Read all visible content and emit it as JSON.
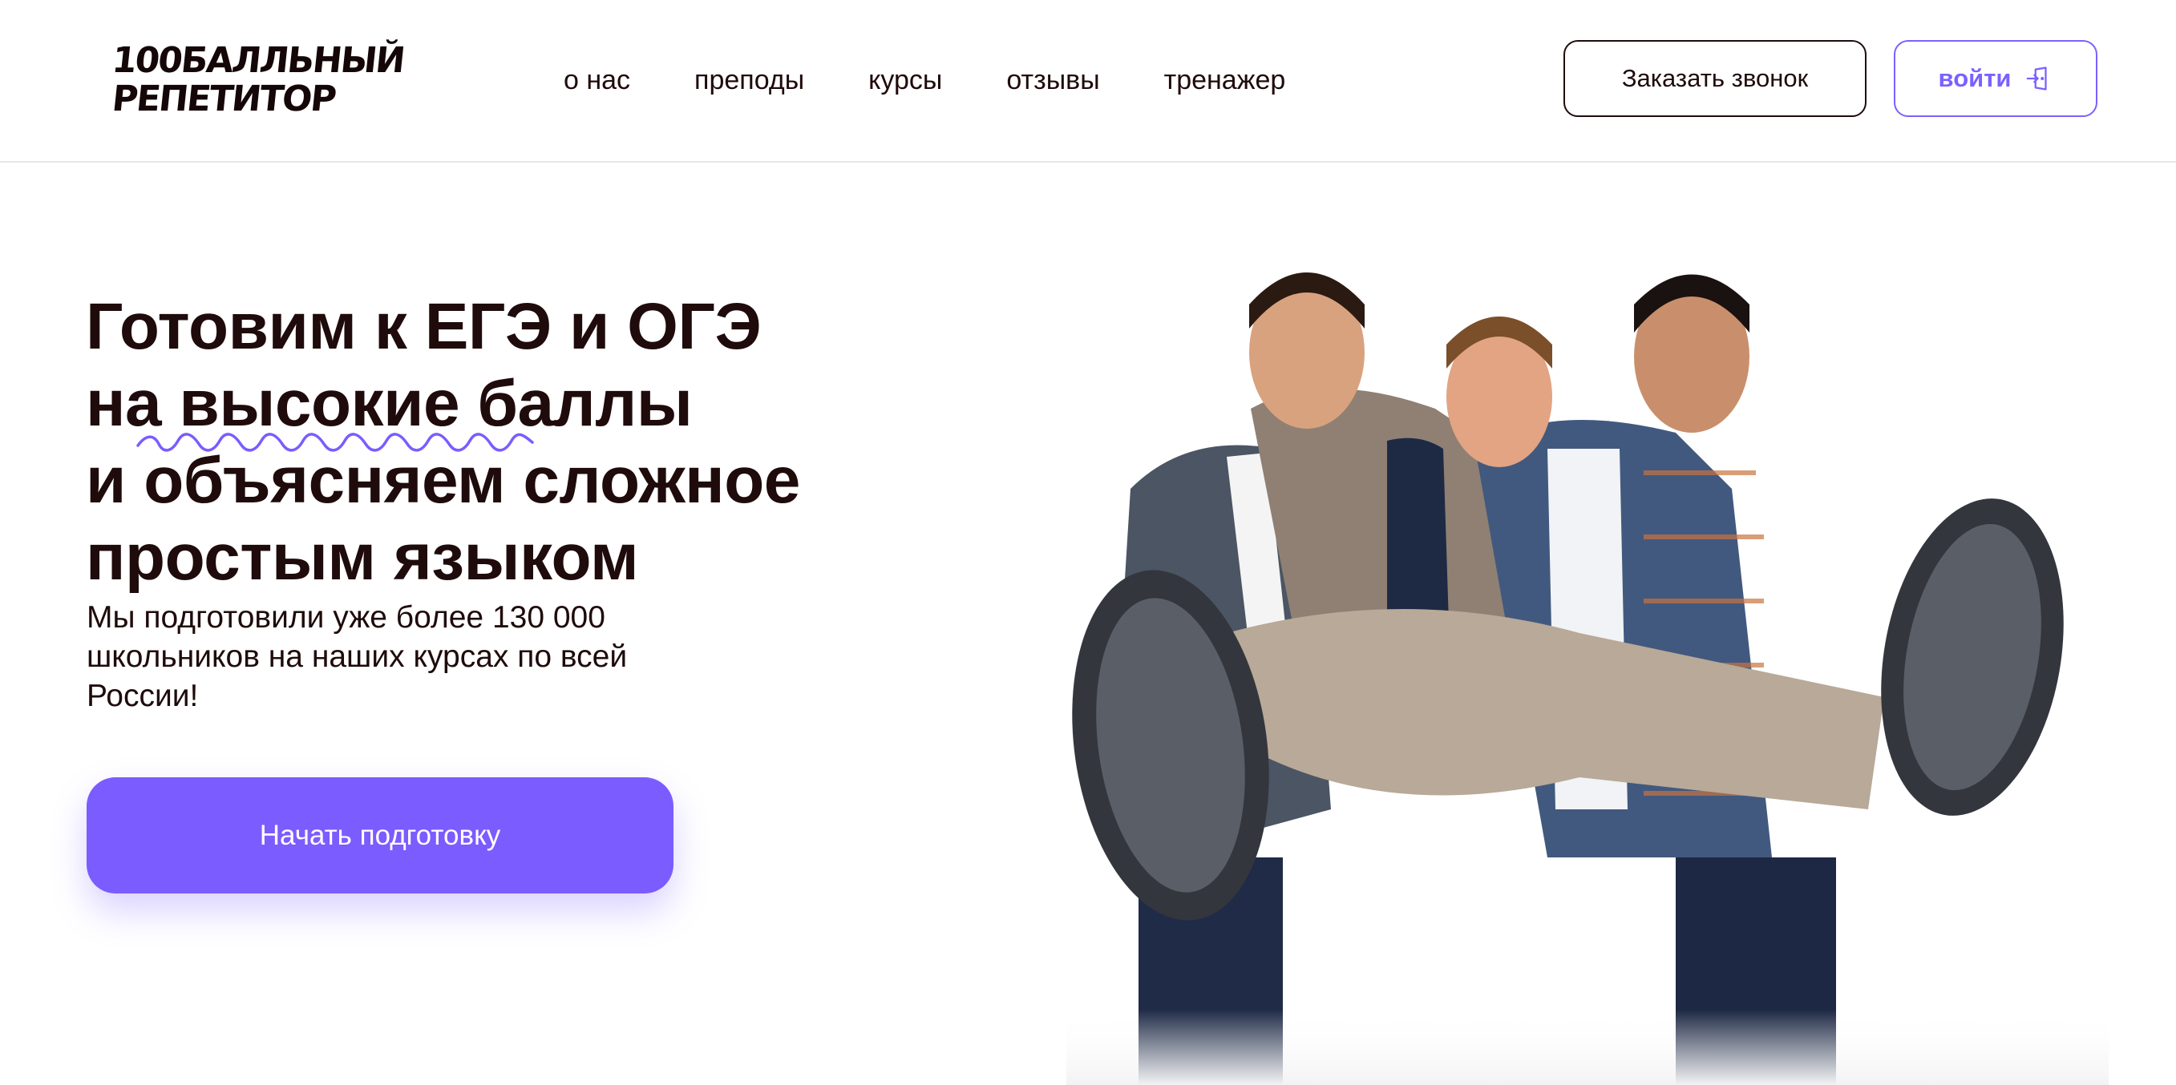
{
  "logo": {
    "line1": "100БАЛЛЬНЫЙ",
    "line2": "РЕПЕТИТОР"
  },
  "nav": {
    "items": [
      "о нас",
      "преподы",
      "курсы",
      "отзывы",
      "тренажер"
    ]
  },
  "header": {
    "call_label": "Заказать звонок",
    "login_label": "войти"
  },
  "hero": {
    "title_lines": [
      "Готовим к ЕГЭ и ОГЭ",
      "на высокие баллы",
      "и объясняем сложное",
      "простым языком"
    ],
    "subtitle": "Мы подготовили уже более 130 000 школьников на наших курсах по всей России!",
    "cta_label": "Начать подготовку"
  },
  "colors": {
    "accent": "#7b5cff",
    "text": "#1f0b0b",
    "border": "#e6e6ea"
  },
  "icons": {
    "login": "login-door-icon",
    "underline": "squiggle-underline"
  }
}
